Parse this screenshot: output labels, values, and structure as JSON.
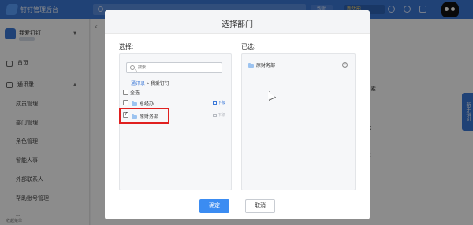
{
  "topbar": {
    "brand": "钉钉管理后台",
    "pill1": "帮助",
    "pill2": "新功能"
  },
  "sidebar": {
    "org_name": "我爱钉钉",
    "items": [
      {
        "label": "首页"
      },
      {
        "label": "通讯录"
      }
    ],
    "sub_items": [
      "成员管理",
      "部门管理",
      "角色管理",
      "智能人事",
      "外部联系人",
      "帮助账号管理",
      "..."
    ],
    "footer": "收起菜单"
  },
  "background": {
    "breadcrumb": "<",
    "right_text_1": "素",
    "right_text_2": "D",
    "right_text_3": "k",
    "side_tab": "新手指引"
  },
  "modal": {
    "title": "选择部门",
    "left_title": "选择:",
    "right_title": "已选:",
    "search_placeholder": "搜索",
    "breadcrumb": {
      "root": "通讯录",
      "sep": ">",
      "current": "我爱钉钉"
    },
    "select_all": "全选",
    "rows": [
      {
        "label": "总经办",
        "checked": false,
        "sub_label": "下级"
      },
      {
        "label": "原财务部",
        "checked": true,
        "sub_label": "下级"
      }
    ],
    "selected": [
      {
        "label": "原财务部"
      }
    ],
    "ok": "确定",
    "cancel": "取消"
  },
  "colors": {
    "accent": "#3b78d8",
    "button": "#3b8cf2",
    "highlight_border": "#e02020"
  }
}
